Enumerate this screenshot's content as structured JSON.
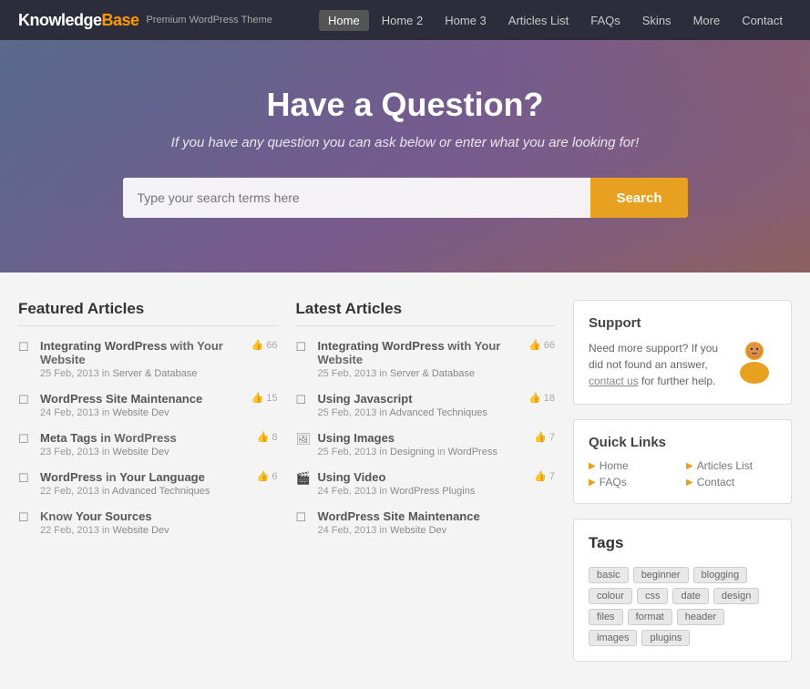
{
  "header": {
    "logo_text": "KnowledgeBase",
    "logo_highlight": "Knowledge",
    "logo_suffix": "Base",
    "logo_sub": "Premium WordPress Theme",
    "nav": [
      {
        "label": "Home",
        "active": true
      },
      {
        "label": "Home 2",
        "active": false
      },
      {
        "label": "Home 3",
        "active": false
      },
      {
        "label": "Articles List",
        "active": false
      },
      {
        "label": "FAQs",
        "active": false
      },
      {
        "label": "Skins",
        "active": false
      },
      {
        "label": "More",
        "active": false
      },
      {
        "label": "Contact",
        "active": false
      }
    ]
  },
  "hero": {
    "title": "Have a Question?",
    "subtitle": "If you have any question you can ask below or enter what you are looking for!",
    "search_placeholder": "Type your search terms here",
    "search_button": "Search"
  },
  "featured": {
    "section_title": "Featured Articles",
    "articles": [
      {
        "title": "Integrating WordPress with Your Website",
        "date": "25 Feb, 2013",
        "category": "Server & Database",
        "votes": "66",
        "icon": "📄"
      },
      {
        "title": "WordPress Site Maintenance",
        "date": "24 Feb, 2013",
        "category": "Website Dev",
        "votes": "15",
        "icon": "📄"
      },
      {
        "title": "Meta Tags in WordPress",
        "date": "23 Feb, 2013",
        "category": "Website Dev",
        "votes": "8",
        "icon": "📄"
      },
      {
        "title": "WordPress in Your Language",
        "date": "22 Feb, 2013",
        "category": "Advanced Techniques",
        "votes": "6",
        "icon": "📄"
      },
      {
        "title": "Know Your Sources",
        "date": "22 Feb, 2013",
        "category": "Website Dev",
        "votes": "",
        "icon": "📄"
      }
    ]
  },
  "latest": {
    "section_title": "Latest Articles",
    "articles": [
      {
        "title": "Integrating WordPress with Your Website",
        "date": "25 Feb, 2013",
        "category": "Server & Database",
        "votes": "66",
        "icon": "📄"
      },
      {
        "title": "Using Javascript",
        "date": "25 Feb, 2013",
        "category": "Advanced Techniques",
        "votes": "18",
        "icon": "📄"
      },
      {
        "title": "Using Images",
        "date": "25 Feb, 2013",
        "category_pre": "Designing",
        "category_in": "WordPress",
        "votes": "7",
        "icon": "🖼"
      },
      {
        "title": "Using Video",
        "date": "24 Feb, 2013",
        "category": "WordPress Plugins",
        "votes": "7",
        "icon": "🎬"
      },
      {
        "title": "WordPress Site Maintenance",
        "date": "24 Feb, 2013",
        "category": "Website Dev",
        "votes": "",
        "icon": "📄"
      }
    ]
  },
  "support": {
    "title": "Support",
    "text": "Need more support? If you did not found an answer, contact us for further help.",
    "contact_label": "contact us"
  },
  "quick_links": {
    "title": "Quick Links",
    "links": [
      {
        "label": "Home"
      },
      {
        "label": "Articles List"
      },
      {
        "label": "FAQs"
      },
      {
        "label": "Contact"
      }
    ]
  },
  "tags": {
    "title": "Tags",
    "items": [
      "basic",
      "beginner",
      "blogging",
      "colour",
      "css",
      "date",
      "design",
      "files",
      "format",
      "header",
      "images",
      "plugins"
    ]
  }
}
